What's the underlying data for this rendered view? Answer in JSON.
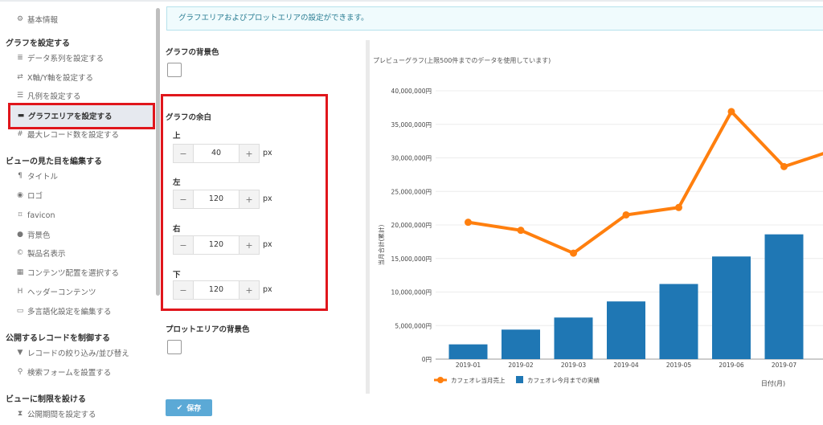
{
  "sidebar": {
    "top_item": {
      "icon": "gear-icon",
      "label": "基本情報"
    },
    "sections": [
      {
        "title": "グラフを設定する",
        "items": [
          {
            "icon": "database-icon",
            "label": "データ系列を設定する"
          },
          {
            "icon": "arrows-icon",
            "label": "X軸/Y軸を設定する"
          },
          {
            "icon": "list-icon",
            "label": "凡例を設定する"
          },
          {
            "icon": "card-icon",
            "label": "グラフエリアを設定する",
            "active": true
          },
          {
            "icon": "hash-icon",
            "label": "最大レコード数を設定する"
          }
        ]
      },
      {
        "title": "ビューの見た目を編集する",
        "items": [
          {
            "icon": "paragraph-icon",
            "label": "タイトル"
          },
          {
            "icon": "eye-icon",
            "label": "ロゴ"
          },
          {
            "icon": "bookmark-icon",
            "label": "favicon"
          },
          {
            "icon": "droplet-icon",
            "label": "背景色"
          },
          {
            "icon": "copyright-icon",
            "label": "製品名表示"
          },
          {
            "icon": "grid-icon",
            "label": "コンテンツ配置を選択する"
          },
          {
            "icon": "header-icon",
            "label": "ヘッダーコンテンツ"
          },
          {
            "icon": "language-icon",
            "label": "多言語化設定を編集する"
          }
        ]
      },
      {
        "title": "公開するレコードを制御する",
        "items": [
          {
            "icon": "filter-icon",
            "label": "レコードの絞り込み/並び替え"
          },
          {
            "icon": "search-icon",
            "label": "検索フォームを設置する"
          }
        ]
      },
      {
        "title": "ビューに制限を設ける",
        "items": [
          {
            "icon": "hourglass-icon",
            "label": "公開期間を設定する"
          }
        ]
      }
    ]
  },
  "info_message": "グラフエリアおよびプロットエリアの設定ができます。",
  "settings": {
    "graph_bg_label": "グラフの背景色",
    "graph_bg_color": "#ffffff",
    "margin_label": "グラフの余白",
    "unit": "px",
    "margins": [
      {
        "label": "上",
        "value": "40"
      },
      {
        "label": "左",
        "value": "120"
      },
      {
        "label": "右",
        "value": "120"
      },
      {
        "label": "下",
        "value": "120"
      }
    ],
    "plot_bg_label": "プロットエリアの背景色",
    "plot_bg_color": "#ffffff",
    "save_label": "保存"
  },
  "preview_title": "プレビューグラフ(上限500件までのデータを使用しています)",
  "chart_data": {
    "type": "bar",
    "categories": [
      "2019-01",
      "2019-02",
      "2019-03",
      "2019-04",
      "2019-05",
      "2019-06",
      "2019-07"
    ],
    "series": [
      {
        "name": "カフェオレ今月までの実績",
        "type": "bar",
        "color": "#1f77b4",
        "values": [
          2200000,
          4400000,
          6200000,
          8600000,
          11200000,
          15300000,
          18600000
        ]
      },
      {
        "name": "カフェオレ当月売上",
        "type": "line",
        "color": "#ff7f0e",
        "values": [
          20400000,
          19200000,
          15800000,
          21500000,
          22600000,
          36900000,
          28700000
        ]
      }
    ],
    "extra_line_value": 31300000,
    "ylabel": "当月合計(累計)",
    "xlabel": "日付(月)",
    "ylim": [
      0,
      40000000
    ],
    "yticks": [
      "0円",
      "5,000,000円",
      "10,000,000円",
      "15,000,000円",
      "20,000,000円",
      "25,000,000円",
      "30,000,000円",
      "35,000,000円",
      "40,000,000円"
    ],
    "grid": true,
    "legend_position": "bottom-left"
  }
}
